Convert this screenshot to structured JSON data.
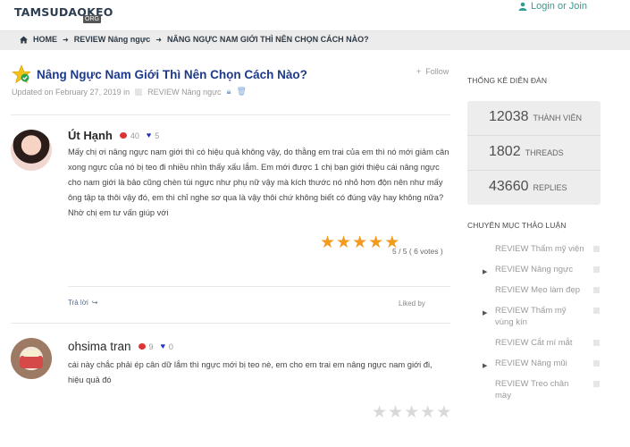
{
  "header": {
    "logo_text": "TAMSUDAOKEO",
    "logo_sub": "ORG",
    "login_label": "Login or Join"
  },
  "breadcrumb": {
    "items": [
      "HOME",
      "REVIEW Nâng ngực",
      "NÂNG NGỰC NAM GIỚI THÌ NÊN CHỌN CÁCH NÀO?"
    ]
  },
  "thread": {
    "title": "Nâng Ngực Nam Giới Thì Nên Chọn Cách Nào?",
    "follow_label": "Follow",
    "updated": "Updated on February 27, 2019 in",
    "forum": "REVIEW Nâng ngực"
  },
  "posts": [
    {
      "author": "Út Hạnh",
      "comments": "40",
      "likes": "5",
      "body": "Mấy chị ơi nâng ngực nam giới thì có hiệu quả không vậy, do thằng em trai của em thì nó mới giảm cân xong ngực của nó bị teo đi nhiều nhìn thấy xấu lắm. Em mới được 1 chị bạn giới thiệu cái nâng ngực cho nam giới là bảo cũng chèn túi ngực như phụ nữ vậy mà kích thước nó nhỏ hơn độn nên như mấy ông tập tạ thôi vậy đó, em thì chỉ nghe sơ qua là vậy thôi chứ không biết có đúng vậy hay không nữa? Nhờ chị em tư vấn giúp với",
      "rating_text": "5 / 5 ( 6 votes )",
      "rating": 5,
      "reply_label": "Trả lời",
      "liked_label": "Liked by"
    },
    {
      "author": "ohsima tran",
      "comments": "9",
      "likes": "0",
      "body": "cái này chắc phải ép cân dữ lắm thì ngực mới bị teo nè, em cho em trai em nâng ngực nam giới đi, hiệu quả đó",
      "rating": 0
    }
  ],
  "sidebar": {
    "stats_title": "THỐNG KÊ DIỄN ĐÀN",
    "stats": [
      {
        "num": "12038",
        "label": "THÀNH VIÊN"
      },
      {
        "num": "1802",
        "label": "THREADS"
      },
      {
        "num": "43660",
        "label": "REPLIES"
      }
    ],
    "forums_title": "CHUYÊN MỤC THẢO LUẬN",
    "forums": [
      {
        "label": "REVIEW Thẩm mỹ viện",
        "arrow": false
      },
      {
        "label": "REVIEW Nâng ngực",
        "arrow": true
      },
      {
        "label": "REVIEW Mẹo làm đẹp",
        "arrow": false
      },
      {
        "label": "REVIEW Thẩm mỹ vùng kín",
        "arrow": true
      },
      {
        "label": "REVIEW Cắt mí mắt",
        "arrow": false
      },
      {
        "label": "REVIEW Nâng mũi",
        "arrow": true
      },
      {
        "label": "REVIEW Treo chân mày",
        "arrow": false
      }
    ]
  },
  "colors": {
    "accent": "#1d3a8a",
    "login": "#2f9e8f",
    "star": "#f39b1c"
  }
}
